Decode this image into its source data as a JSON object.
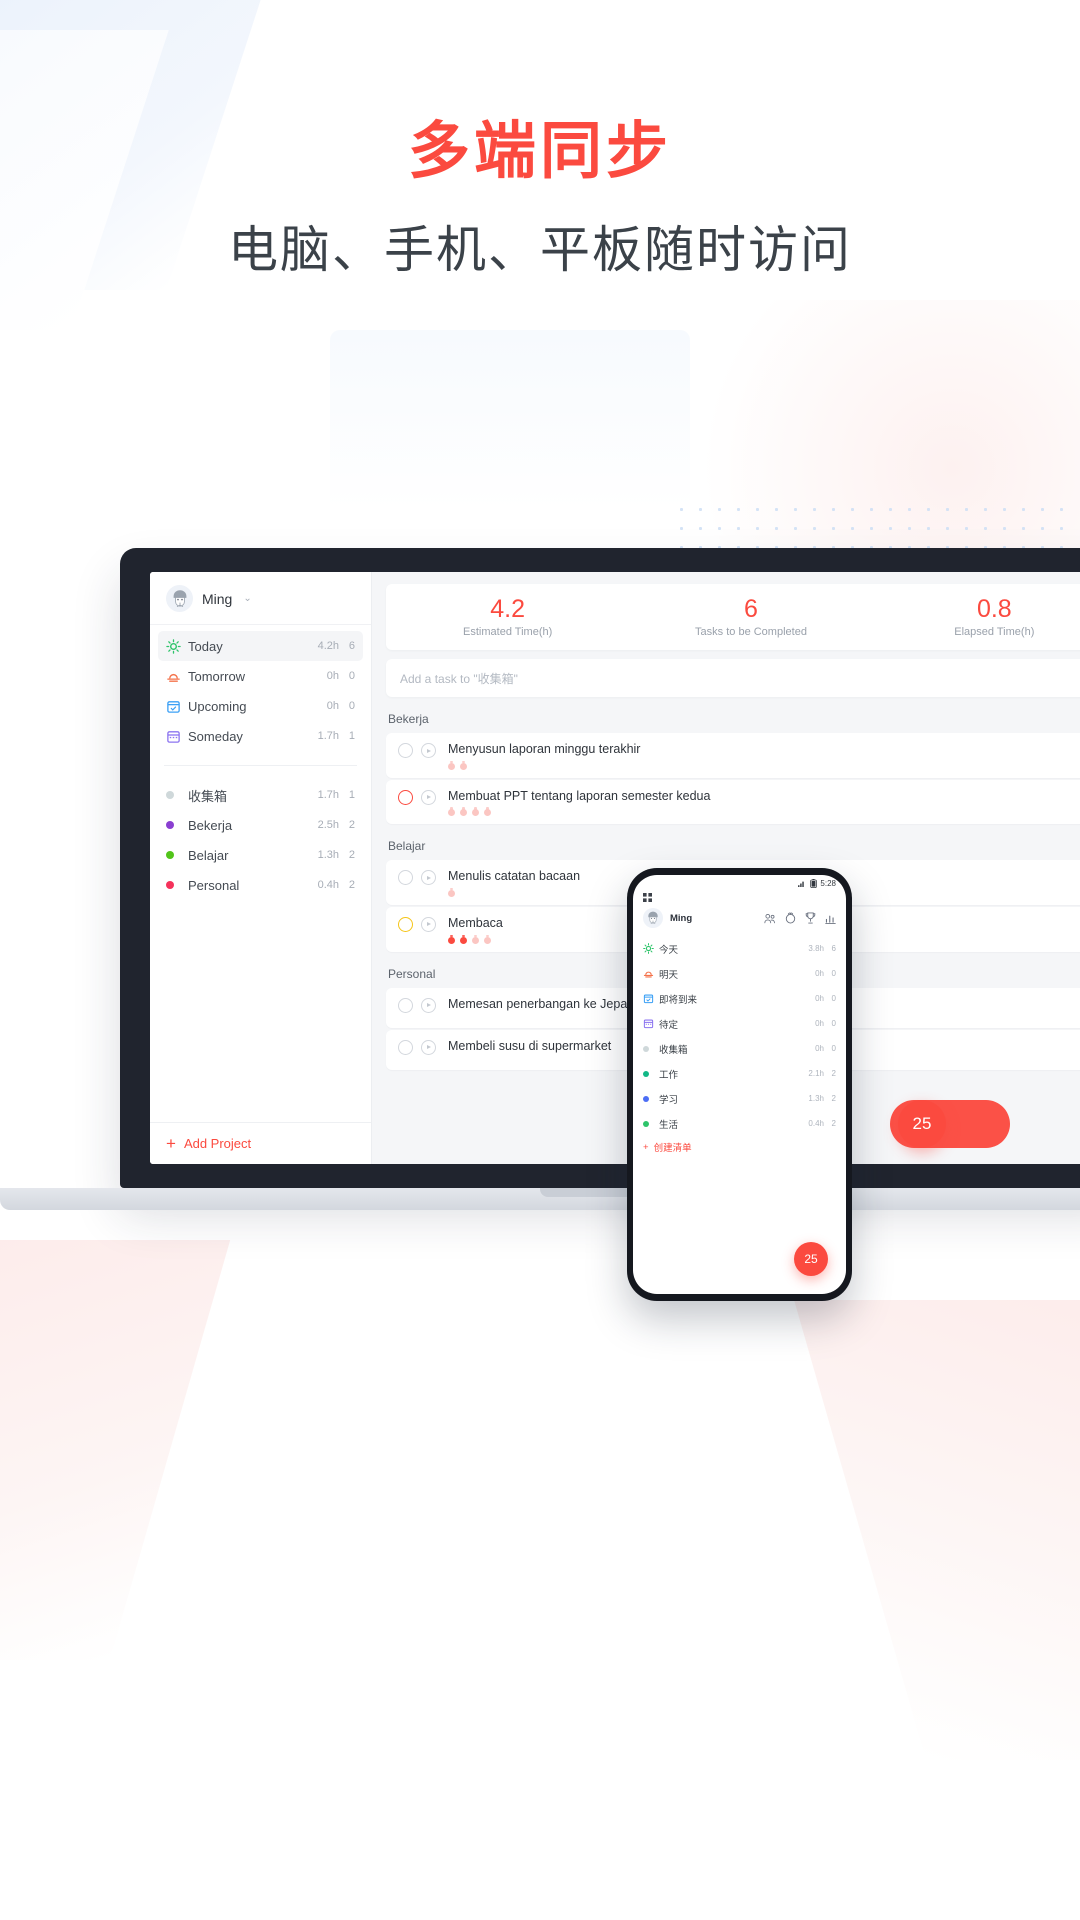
{
  "hero": {
    "title": "多端同步",
    "subtitle": "电脑、手机、平板随时访问",
    "title_color": "#fb4a3f",
    "subtitle_color": "#3b4249"
  },
  "laptop": {
    "sidebar": {
      "user": {
        "name": "Ming",
        "caret": "⌄",
        "avatar_icon": "user-avatar-icon"
      },
      "smart_lists": [
        {
          "label": "Today",
          "hours": "4.2h",
          "count": "6",
          "icon": "sun-icon",
          "color": "#2ec46a",
          "active": true
        },
        {
          "label": "Tomorrow",
          "hours": "0h",
          "count": "0",
          "icon": "sunrise-icon",
          "color": "#f4724a",
          "active": false
        },
        {
          "label": "Upcoming",
          "hours": "0h",
          "count": "0",
          "icon": "calendar-check-icon",
          "color": "#3ba0f5",
          "active": false
        },
        {
          "label": "Someday",
          "hours": "1.7h",
          "count": "1",
          "icon": "calendar-icon",
          "color": "#8c74f0",
          "active": false
        }
      ],
      "projects": [
        {
          "label": "收集箱",
          "hours": "1.7h",
          "count": "1",
          "color": "#cfd8da"
        },
        {
          "label": "Bekerja",
          "hours": "2.5h",
          "count": "2",
          "color": "#8a3fd1"
        },
        {
          "label": "Belajar",
          "hours": "1.3h",
          "count": "2",
          "color": "#52c41a"
        },
        {
          "label": "Personal",
          "hours": "0.4h",
          "count": "2",
          "color": "#f5325b"
        }
      ],
      "add_project": {
        "label": "Add Project",
        "plus": "+"
      }
    },
    "main": {
      "stats": [
        {
          "value": "4.2",
          "label": "Estimated Time(h)"
        },
        {
          "value": "6",
          "label": "Tasks to be Completed"
        },
        {
          "value": "0.8",
          "label": "Elapsed Time(h)"
        }
      ],
      "add_task_placeholder": "Add a task to \"收集箱\"",
      "sections": [
        {
          "title": "Bekerja",
          "tasks": [
            {
              "title": "Menyusun laporan minggu terakhir",
              "check": "grey",
              "tomatoes": 2,
              "tomatoes_full": 0
            },
            {
              "title": "Membuat PPT tentang laporan semester kedua",
              "check": "red",
              "tomatoes": 4,
              "tomatoes_full": 0
            }
          ]
        },
        {
          "title": "Belajar",
          "tasks": [
            {
              "title": "Menulis catatan bacaan",
              "check": "grey",
              "tomatoes": 1,
              "tomatoes_full": 0
            },
            {
              "title": "Membaca",
              "check": "yellow",
              "tomatoes": 4,
              "tomatoes_full": 2
            }
          ]
        },
        {
          "title": "Personal",
          "tasks": [
            {
              "title": "Memesan penerbangan ke Jepang",
              "check": "grey",
              "tomatoes": 0,
              "tomatoes_full": 0
            },
            {
              "title": "Membeli susu di supermarket",
              "check": "grey",
              "tomatoes": 0,
              "tomatoes_full": 0
            }
          ]
        }
      ],
      "timer_badge": "25"
    }
  },
  "phone": {
    "status": {
      "time": "5:28",
      "signal_icon": "signal-icon",
      "battery_icon": "battery-icon"
    },
    "grip_icon": "drag-handle-icon",
    "user": {
      "name": "Ming",
      "avatar_icon": "user-avatar-icon"
    },
    "header_icons": [
      "friends-icon",
      "pomodoro-icon",
      "achievement-icon",
      "stats-icon"
    ],
    "smart_lists": [
      {
        "label": "今天",
        "hours": "3.8h",
        "count": "6",
        "icon": "sun-icon",
        "color": "#2ec46a"
      },
      {
        "label": "明天",
        "hours": "0h",
        "count": "0",
        "icon": "sunrise-icon",
        "color": "#f4724a"
      },
      {
        "label": "即将到来",
        "hours": "0h",
        "count": "0",
        "icon": "calendar-check-icon",
        "color": "#3ba0f5"
      },
      {
        "label": "待定",
        "hours": "0h",
        "count": "0",
        "icon": "calendar-icon",
        "color": "#8c74f0"
      }
    ],
    "projects": [
      {
        "label": "收集箱",
        "hours": "0h",
        "count": "0",
        "color": "#cfd8da"
      },
      {
        "label": "工作",
        "hours": "2.1h",
        "count": "2",
        "color": "#12b886"
      },
      {
        "label": "学习",
        "hours": "1.3h",
        "count": "2",
        "color": "#4c6ef5"
      },
      {
        "label": "生活",
        "hours": "0.4h",
        "count": "2",
        "color": "#2ec46a"
      }
    ],
    "add_list": {
      "label": "创建清单",
      "plus": "+"
    },
    "fab_badge": "25"
  }
}
